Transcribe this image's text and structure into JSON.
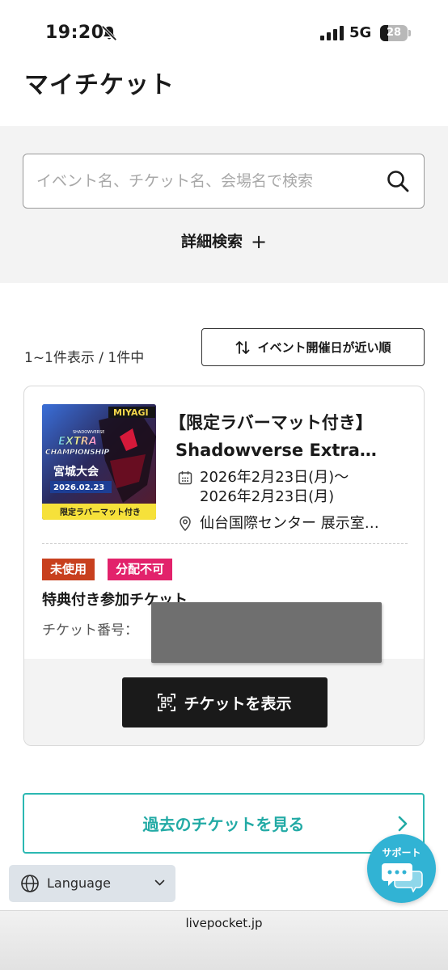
{
  "status_bar": {
    "time": "19:20",
    "network": "5G",
    "battery": "28",
    "icons": [
      "bell-slash-icon",
      "signal-icon",
      "battery-icon"
    ]
  },
  "header": {
    "title": "マイチケット"
  },
  "search": {
    "placeholder": "イベント名、チケット名、会場名で検索",
    "advanced_label": "詳細検索",
    "advanced_icon": "plus-icon"
  },
  "results": {
    "count_text": "1~1件表示 / 1件中",
    "sort_label": "イベント開催日が近い順"
  },
  "ticket": {
    "title_line1": "【限定ラバーマット付き】",
    "title_line2": "Shadowverse Extra…",
    "date_start": "2026年2月23日(月)〜",
    "date_end": "2026年2月23日(月)",
    "venue": "仙台国際センター 展示室…",
    "badges": [
      "未使用",
      "分配不可"
    ],
    "type": "特典付き参加チケット",
    "number_label": "チケット番号：",
    "show_button": "チケットを表示",
    "image": {
      "region": "MIYAGI",
      "brand": "SHADOWVERSE",
      "line1": "EXTRA",
      "line2": "CHAMPIONSHIP",
      "event": "宮城大会",
      "date": "2026.02.23",
      "banner": "限定ラバーマット付き"
    }
  },
  "past_tickets": {
    "label": "過去のチケットを見る"
  },
  "support": {
    "label": "サポート"
  },
  "language": {
    "label": "Language"
  },
  "browser": {
    "url": "livepocket.jp"
  },
  "colors": {
    "accent_teal": "#2bb8b2",
    "badge_unused": "#c8401e",
    "badge_nontransfer": "#e2226b",
    "support_blue": "#31b3d4"
  }
}
